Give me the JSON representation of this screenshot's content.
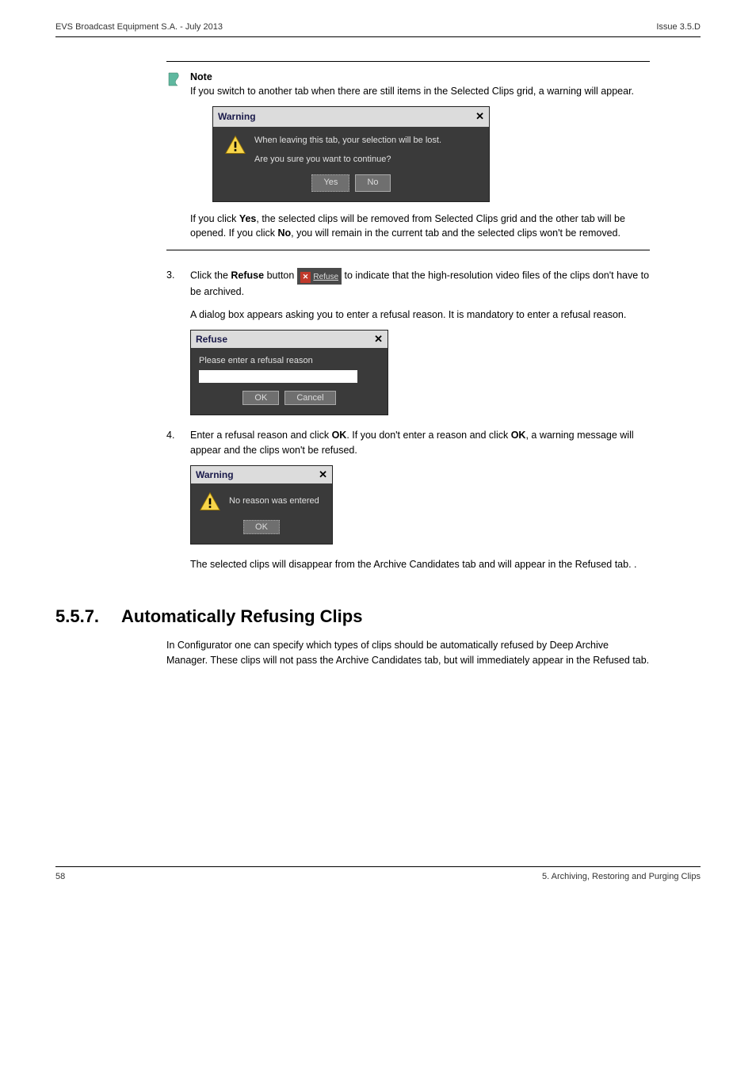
{
  "header": {
    "left": "EVS Broadcast Equipment S.A. - July 2013",
    "right": "Issue 3.5.D"
  },
  "note": {
    "label": "Note",
    "text1": "If you switch to another tab when there are still items in the Selected Clips grid, a warning will appear.",
    "after": "If you click ",
    "yes": "Yes",
    "after2": ", the selected clips will be removed from Selected Clips grid and the other tab will be opened. If you click ",
    "no": "No",
    "after3": ", you will remain in the current tab and the selected clips won't be removed."
  },
  "dlg1": {
    "title": "Warning",
    "line1": "When leaving this tab, your selection will be lost.",
    "line2": "Are you sure you want to continue?",
    "yes": "Yes",
    "no": "No"
  },
  "step3": {
    "num": "3.",
    "pre": "Click the ",
    "refuse": "Refuse",
    "btn": "Refuse",
    "post": " button ",
    "post2": " to indicate that the high-resolution video files of the clips don't have to be archived.",
    "sub": "A dialog box appears asking you to enter a refusal reason. It is mandatory to enter a refusal reason."
  },
  "dlg2": {
    "title": "Refuse",
    "label": "Please enter a refusal reason",
    "ok": "OK",
    "cancel": "Cancel"
  },
  "step4": {
    "num": "4.",
    "pre": "Enter a refusal reason and click ",
    "ok": "OK",
    "mid": ". If you don't enter a reason and click ",
    "ok2": "OK",
    "post": ", a warning message will appear and the clips won't be refused."
  },
  "dlg3": {
    "title": "Warning",
    "msg": "No reason was entered",
    "ok": "OK"
  },
  "last_p": "The selected clips will disappear from the Archive Candidates tab and will appear in the Refused tab. .",
  "heading": {
    "num": "5.5.7.",
    "title": "Automatically Refusing Clips"
  },
  "body": "In Configurator one can specify which types of clips should be automatically refused by Deep Archive Manager. These clips will not pass the Archive Candidates tab, but will immediately appear in the Refused tab.",
  "footer": {
    "left": "58",
    "right": "5. Archiving, Restoring and Purging Clips"
  }
}
